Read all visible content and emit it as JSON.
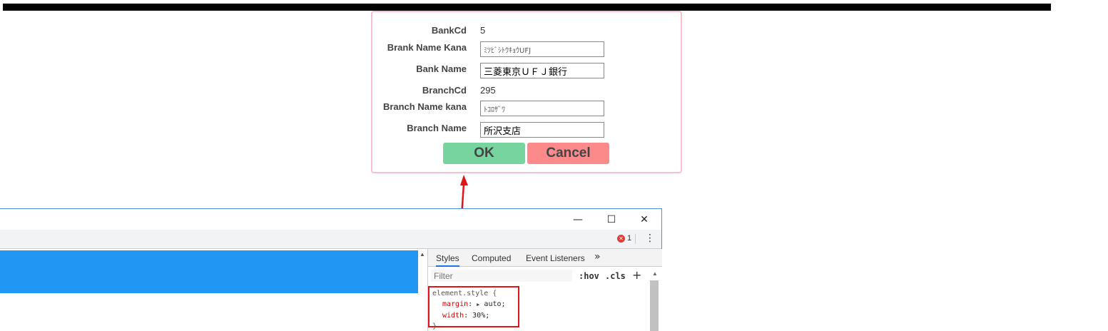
{
  "form": {
    "rows": [
      {
        "label": "BankCd",
        "value": "5",
        "type": "text"
      },
      {
        "label": "Brank Name Kana",
        "value": "ﾐﾂﾋﾞｼﾄｳｷｮｳUFJ",
        "type": "input"
      },
      {
        "label": "Bank Name",
        "value": "三菱東京ＵＦＪ銀行",
        "type": "input"
      },
      {
        "label": "BranchCd",
        "value": "295",
        "type": "text"
      },
      {
        "label": "Branch Name kana",
        "value": "ﾄｺﾛｻﾞﾜ",
        "type": "input"
      },
      {
        "label": "Branch Name",
        "value": "所沢支店",
        "type": "input"
      }
    ],
    "ok_label": "OK",
    "cancel_label": "Cancel"
  },
  "devtools": {
    "window_controls": {
      "minimize": "—",
      "maximize": "☐",
      "close": "✕"
    },
    "error_count": "1",
    "tabs": [
      {
        "label": "Styles",
        "active": true
      },
      {
        "label": "Computed",
        "active": false
      },
      {
        "label": "Event Listeners",
        "active": false
      }
    ],
    "more_tabs": "»",
    "filter_placeholder": "Filter",
    "hov_label": ":hov",
    "cls_label": ".cls",
    "new_rule": "+",
    "style_rule": {
      "selector": "element.style {",
      "declarations": [
        {
          "prop": "margin",
          "value": "auto;",
          "expandable": true
        },
        {
          "prop": "width",
          "value": "30%;",
          "expandable": false
        }
      ],
      "close": "}"
    }
  },
  "colors": {
    "ok_bg": "#77d49f",
    "cancel_bg": "#fc8a8a",
    "dialog_border": "#f6c0cc",
    "highlight_red": "#e0151b",
    "devtools_blue": "#2196f3"
  }
}
